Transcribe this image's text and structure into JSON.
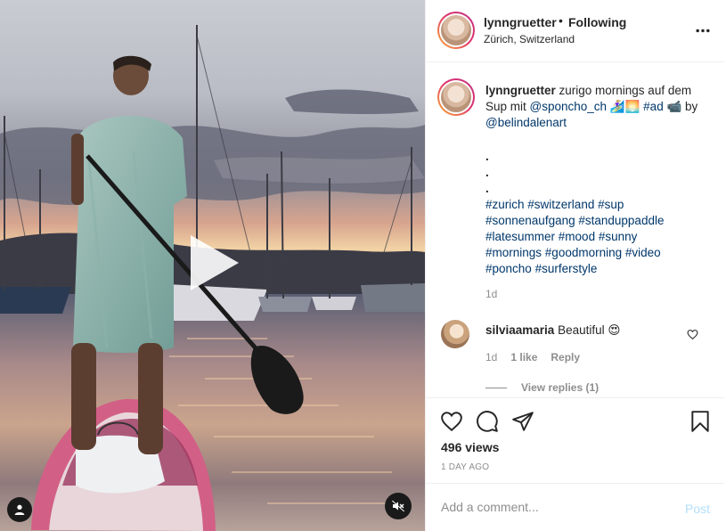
{
  "post": {
    "author": "lynngruetter",
    "follow_separator": "•",
    "follow_status": "Following",
    "location": "Zürich, Switzerland",
    "more_icon": "more-horizontal-icon"
  },
  "caption": {
    "username": "lynngruetter",
    "text_1": " zurigo mornings auf dem Sup mit ",
    "mention_1": "@sponcho_ch",
    "text_2": " 🏄🏼‍♀️🌅 ",
    "hashtag_ad": "#ad",
    "text_3": " 📹 by ",
    "mention_2": "@belindalenart",
    "dot_lines": [
      ".",
      ".",
      "."
    ],
    "hashtags": [
      "#zurich",
      "#switzerland",
      "#sup",
      "#sonnenaufgang",
      "#standuppaddle",
      "#latesummer",
      "#mood",
      "#sunny",
      "#mornings",
      "#goodmorning",
      "#video",
      "#poncho",
      "#surferstyle"
    ],
    "age": "1d"
  },
  "comment": {
    "username": "silviaamaria",
    "text": " Beautiful 😍",
    "age": "1d",
    "likes": "1 like",
    "reply": "Reply",
    "view_replies": "View replies (1)"
  },
  "stats": {
    "views": "496 views",
    "date": "1 DAY AGO"
  },
  "add_comment": {
    "placeholder": "Add a comment...",
    "post_label": "Post"
  },
  "colors": {
    "link": "#00376b",
    "muted": "#8e8e8e",
    "post_disabled": "#b2dffc"
  },
  "icons": {
    "play": "play-icon",
    "user_tag": "user-tag-icon",
    "mute": "sound-off-icon",
    "like": "heart-icon",
    "comment": "comment-icon",
    "share": "paper-plane-icon",
    "save": "bookmark-icon"
  }
}
